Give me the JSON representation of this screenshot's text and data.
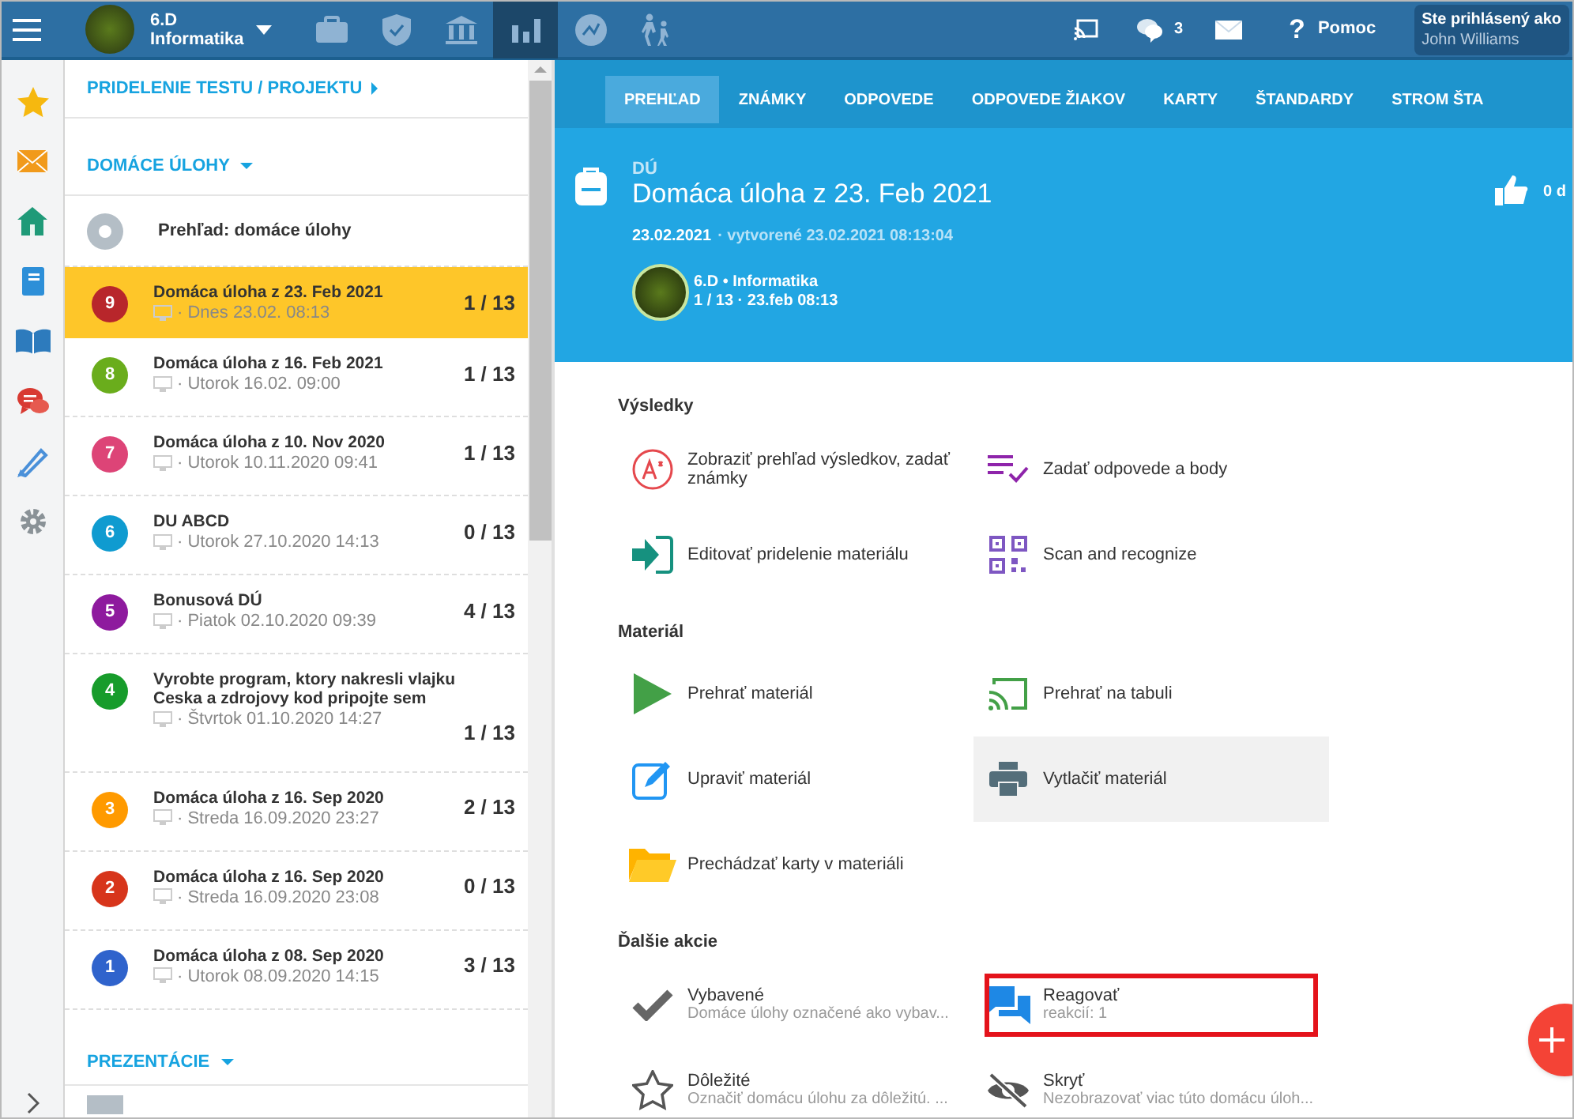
{
  "topbar": {
    "class_name": "6.D",
    "class_subject": "Informatika",
    "nav_icons": [
      {
        "selected": false
      },
      {
        "selected": false
      },
      {
        "selected": false
      },
      {
        "selected": true
      },
      {
        "selected": false
      },
      {
        "selected": false
      }
    ],
    "messages_count": "3",
    "help_icon": "?",
    "help": "Pomoc",
    "user_label": "Ste prihlásený ako",
    "user_name": "John Williams"
  },
  "sidebar": {
    "assign_link": "PRIDELENIE TESTU / PROJEKTU",
    "homework_header": "DOMÁCE ÚLOHY",
    "overview": "Prehľad: domáce úlohy",
    "items": [
      {
        "badge": "9",
        "color": "#b8262b",
        "title": "Domáca úloha z 23. Feb 2021",
        "subtitle": "· Dnes 23.02. 08:13",
        "count": "1 / 13",
        "selected": true
      },
      {
        "badge": "8",
        "color": "#6aad1c",
        "title": "Domáca úloha z 16. Feb 2021",
        "subtitle": "· Utorok 16.02. 09:00",
        "count": "1 / 13",
        "selected": false
      },
      {
        "badge": "7",
        "color": "#dd4477",
        "title": "Domáca úloha z 10. Nov 2020",
        "subtitle": "· Utorok 10.11.2020 09:41",
        "count": "1 / 13",
        "selected": false
      },
      {
        "badge": "6",
        "color": "#0f9bd0",
        "title": "DU ABCD",
        "subtitle": "· Utorok 27.10.2020 14:13",
        "count": "0 / 13",
        "selected": false
      },
      {
        "badge": "5",
        "color": "#8e1a9e",
        "title": "Bonusová DÚ",
        "subtitle": "· Piatok 02.10.2020 09:39",
        "count": "4 / 13",
        "selected": false
      },
      {
        "badge": "4",
        "color": "#179c2b",
        "title": "Vyrobte program, ktory nakresli vlajku Ceska a zdrojovy kod pripojte sem",
        "subtitle": "· Štvrtok 01.10.2020 14:27",
        "count": "1 / 13",
        "selected": false
      },
      {
        "badge": "3",
        "color": "#ff9a00",
        "title": "Domáca úloha z 16. Sep 2020",
        "subtitle": "· Streda 16.09.2020 23:27",
        "count": "2 / 13",
        "selected": false
      },
      {
        "badge": "2",
        "color": "#d7351b",
        "title": "Domáca úloha z 16. Sep 2020",
        "subtitle": "· Streda 16.09.2020 23:08",
        "count": "0 / 13",
        "selected": false
      },
      {
        "badge": "1",
        "color": "#2f63cc",
        "title": "Domáca úloha z 08. Sep 2020",
        "subtitle": "· Utorok 08.09.2020 14:15",
        "count": "3 / 13",
        "selected": false
      }
    ],
    "presentations_header": "PREZENTÁCIE"
  },
  "tabs": [
    {
      "label": "PREHĽAD",
      "selected": true
    },
    {
      "label": "ZNÁMKY",
      "selected": false
    },
    {
      "label": "ODPOVEDE",
      "selected": false
    },
    {
      "label": "ODPOVEDE ŽIAKOV",
      "selected": false
    },
    {
      "label": "KARTY",
      "selected": false
    },
    {
      "label": "ŠTANDARDY",
      "selected": false
    },
    {
      "label": "STROM ŠTA",
      "selected": false
    }
  ],
  "header": {
    "type": "DÚ",
    "title": "Domáca úloha z 23. Feb 2021",
    "date": "23.02.2021",
    "created": "· vytvorené 23.02.2021 08:13:04",
    "class": "6.D • Informatika",
    "progress": "1 / 13 · 23.feb 08:13",
    "likes": "0 d"
  },
  "sections": [
    {
      "title": "Výsledky",
      "actions": [
        {
          "label": "Zobraziť prehľad výsledkov, zadať známky",
          "hovered": false,
          "annotated": false
        },
        {
          "label": "Zadať odpovede a body",
          "hovered": false,
          "annotated": false
        },
        {
          "label": "Editovať pridelenie materiálu",
          "hovered": false,
          "annotated": false
        },
        {
          "label": "Scan and recognize",
          "hovered": false,
          "annotated": false
        }
      ]
    },
    {
      "title": "Materiál",
      "actions": [
        {
          "label": "Prehrať materiál",
          "hovered": false,
          "annotated": false
        },
        {
          "label": "Prehrať na tabuli",
          "hovered": false,
          "annotated": false
        },
        {
          "label": "Upraviť materiál",
          "hovered": false,
          "annotated": false
        },
        {
          "label": "Vytlačiť materiál",
          "hovered": true,
          "annotated": false
        },
        {
          "label": "Prechádzať karty v materiáli",
          "hovered": false,
          "annotated": false
        }
      ]
    },
    {
      "title": "Ďalšie akcie",
      "actions": [
        {
          "label": "Vybavené",
          "sublabel": "Domáce úlohy označené ako vybav...",
          "hovered": false,
          "annotated": false
        },
        {
          "label": "Reagovať",
          "sublabel": "reakcií: 1",
          "hovered": false,
          "annotated": true
        },
        {
          "label": "Dôležité",
          "sublabel": "Označiť domácu úlohu za dôležitú. ...",
          "hovered": false,
          "annotated": false
        },
        {
          "label": "Skryť",
          "sublabel": "Nezobrazovať viac túto domácu úloh...",
          "hovered": false,
          "annotated": false
        }
      ]
    }
  ]
}
